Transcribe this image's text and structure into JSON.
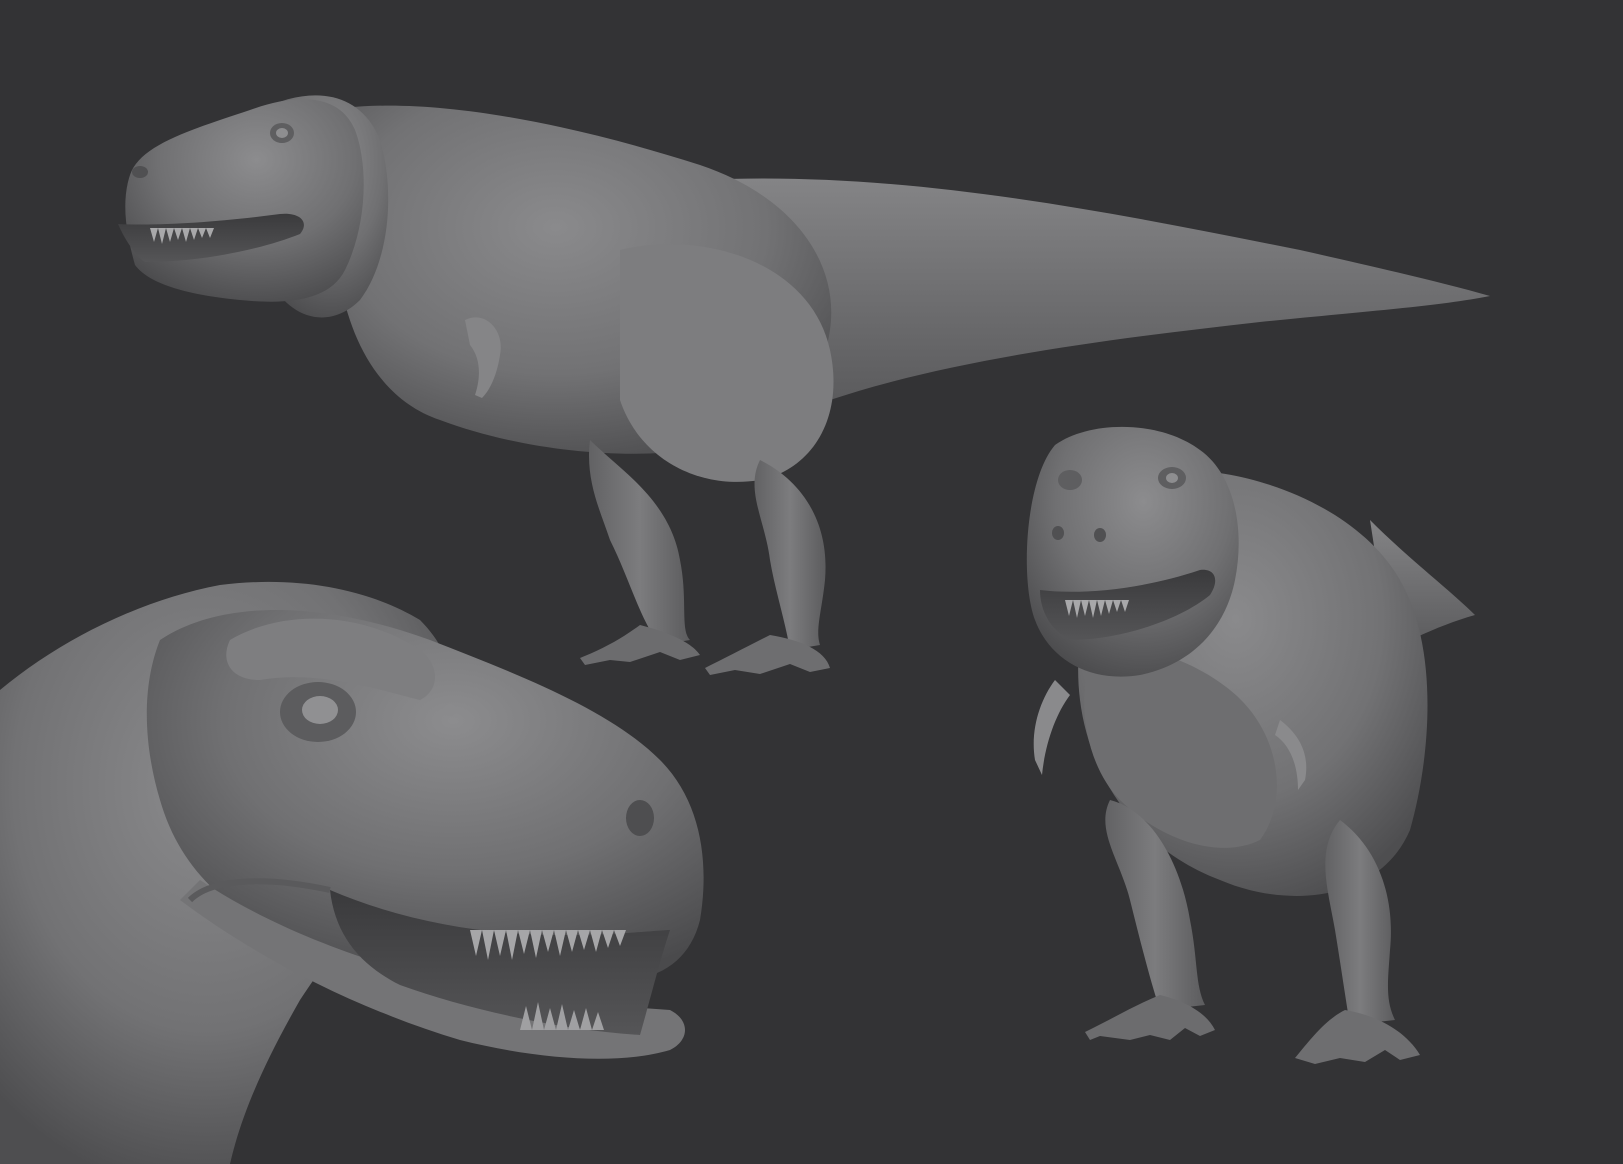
{
  "scene": {
    "background_color": "#333335",
    "model_material_color": "#7a7a7c",
    "views": [
      {
        "id": "side-view"
      },
      {
        "id": "front-three-quarter-view"
      },
      {
        "id": "head-closeup-view"
      }
    ]
  }
}
